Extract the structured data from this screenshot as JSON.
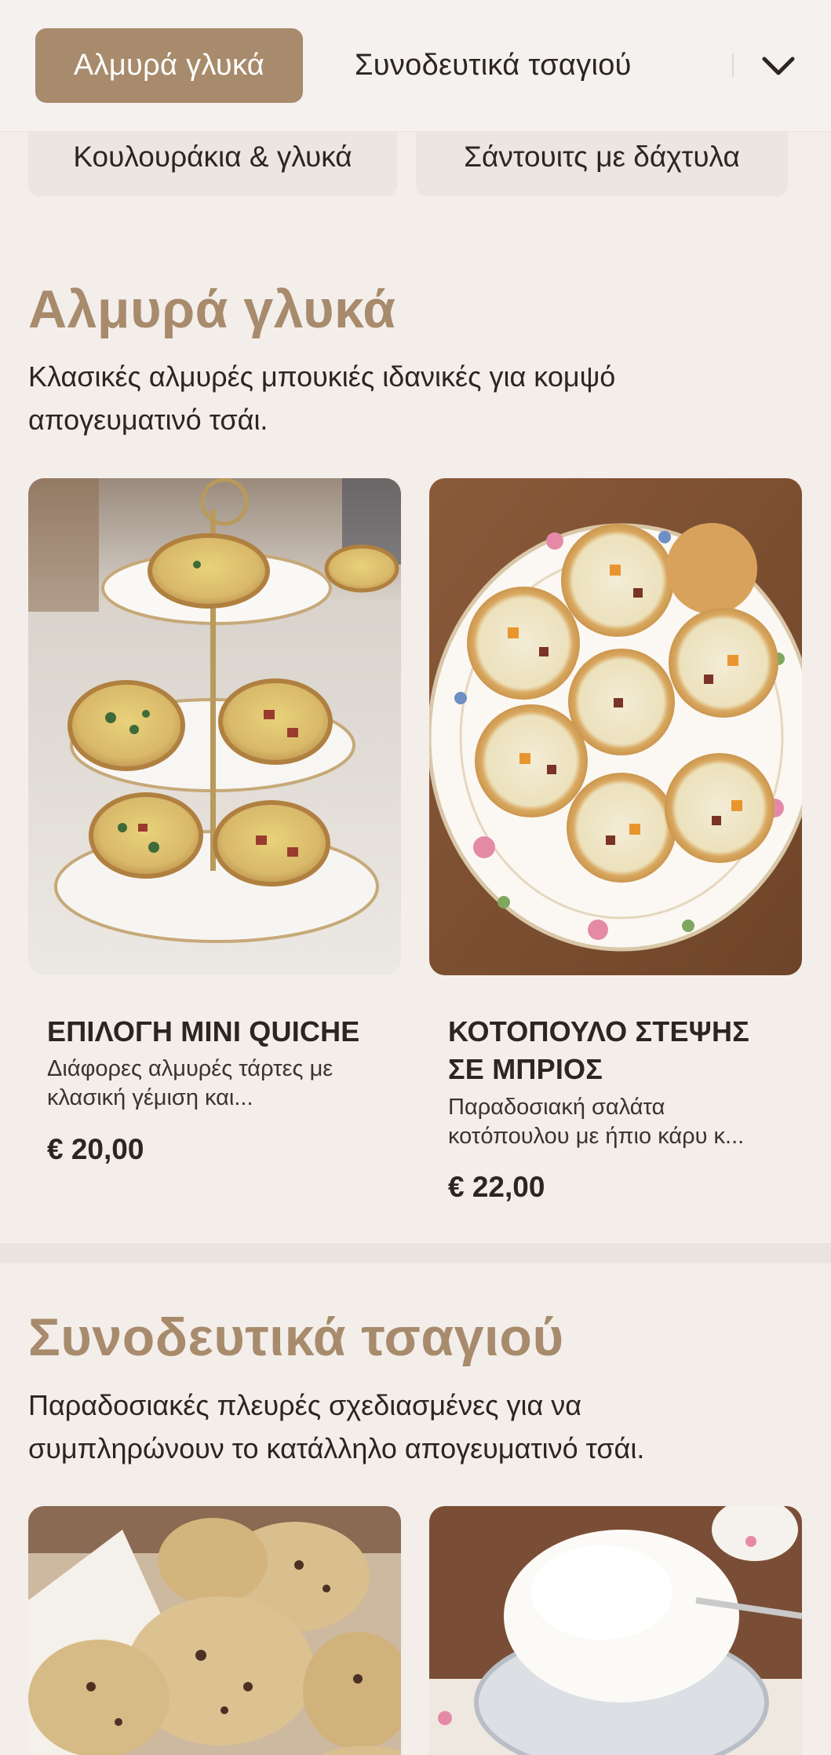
{
  "header": {
    "tabs": [
      {
        "label": "Αλμυρά γλυκά",
        "active": true
      },
      {
        "label": "Συνοδευτικά τσαγιού",
        "active": false
      }
    ],
    "more_icon": "chevron-down-icon"
  },
  "chips": [
    "Κουλουράκια & γλυκά",
    "Σάντουιτς με δάχτυλα"
  ],
  "sections": [
    {
      "title": "Αλμυρά γλυκά",
      "description": "Κλασικές αλμυρές μπουκιές ιδανικές για κομψό απογευματινό τσάι.",
      "items": [
        {
          "name": "ΕΠΙΛΟΓΗ MINI QUICHE",
          "description": "Διάφορες αλμυρές τάρτες με κλασική γέμιση και...",
          "price": "€ 20,00"
        },
        {
          "name": "ΚΟΤΟΠΟΥΛΟ ΣΤΕΨΗΣ ΣΕ ΜΠΡΙΟΣ",
          "description": "Παραδοσιακή σαλάτα κοτόπουλου με ήπιο κάρυ κ...",
          "price": "€ 22,00"
        }
      ]
    },
    {
      "title": "Συνοδευτικά τσαγιού",
      "description": "Παραδοσιακές πλευρές σχεδιασμένες για να συμπληρώνουν το κατάλληλο απογευματινό τσάι."
    }
  ],
  "colors": {
    "accent": "#a88b6c",
    "background": "#f3eeea",
    "text": "#2c2520",
    "chip": "#ede6e0"
  }
}
